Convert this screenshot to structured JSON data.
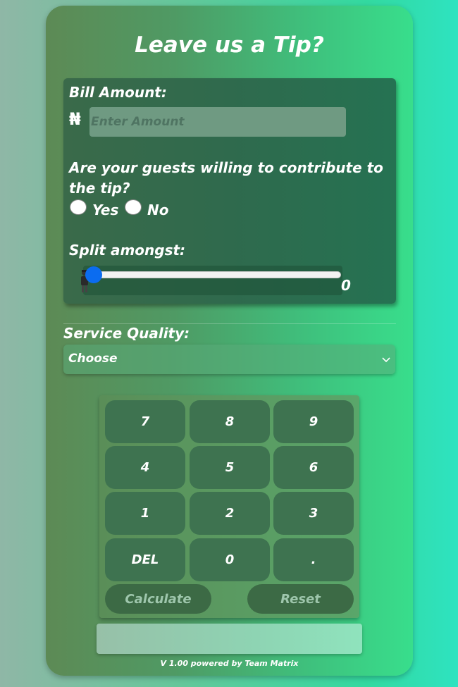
{
  "app": {
    "title": "Leave us a Tip?",
    "footer": "V 1.00 powered by Team Matrix"
  },
  "bill": {
    "label": "Bill Amount:",
    "currency_symbol": "₦",
    "placeholder": "Enter Amount",
    "value": ""
  },
  "guests": {
    "question": "Are your guests willing to contribute to the tip?",
    "options": [
      "Yes",
      "No"
    ],
    "selected": null
  },
  "split": {
    "label": "Split amongst:",
    "value": "0",
    "slider_level": 0
  },
  "service": {
    "label": "Service Quality:",
    "selected": "Choose"
  },
  "keypad": {
    "keys": [
      "7",
      "8",
      "9",
      "4",
      "5",
      "6",
      "1",
      "2",
      "3",
      "DEL",
      "0",
      "."
    ],
    "calculate_label": "Calculate",
    "reset_label": "Reset"
  },
  "result": {
    "value": ""
  },
  "colors": {
    "slider_thumb": "#0b6cf0",
    "key_bg": "#3e7350",
    "card_accent": "#38de8c"
  },
  "icons": {
    "select": "chevron-down-icon",
    "slider": "person-figure-icon"
  }
}
